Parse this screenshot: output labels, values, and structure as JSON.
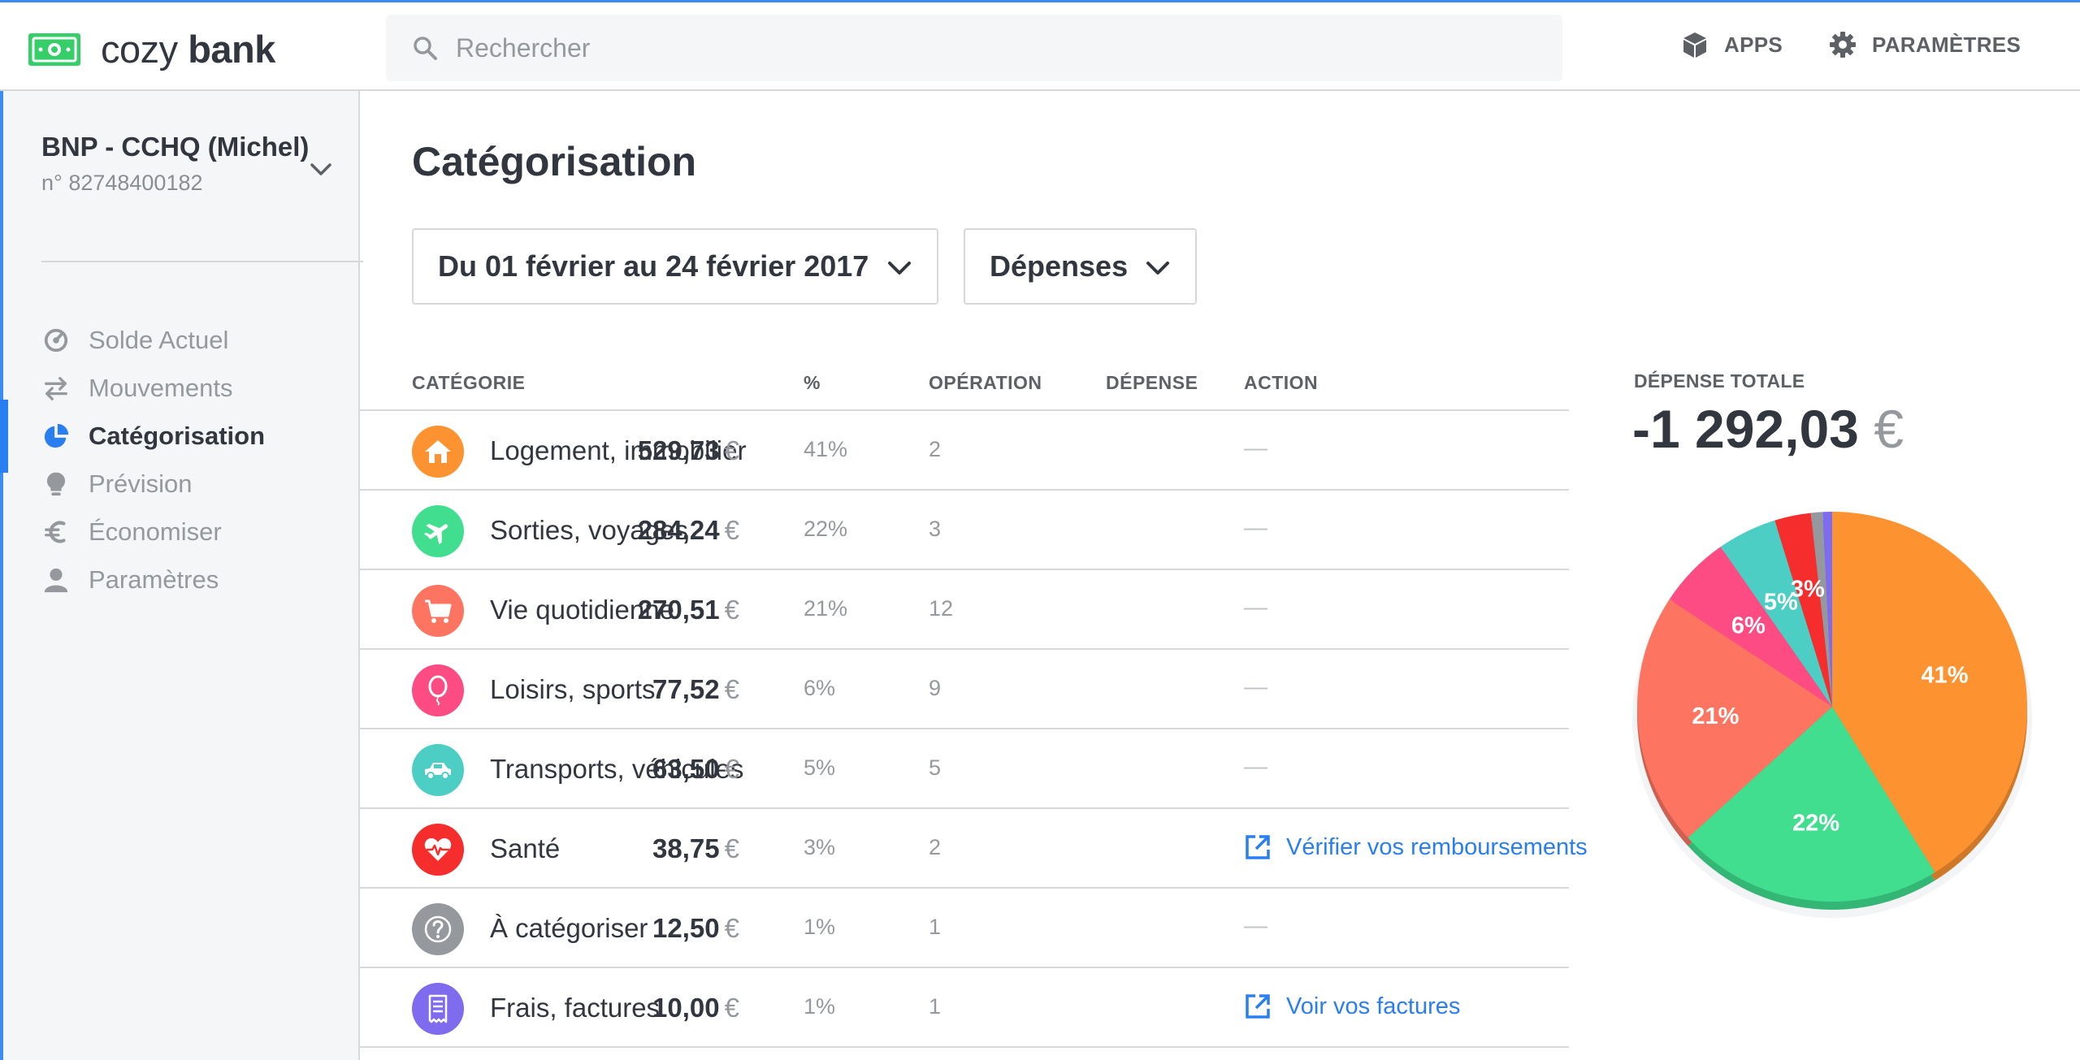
{
  "app": {
    "name_light": "cozy",
    "name_bold": "bank"
  },
  "search": {
    "placeholder": "Rechercher"
  },
  "topnav": {
    "apps_label": "APPS",
    "settings_label": "PARAMÈTRES"
  },
  "account": {
    "name": "BNP - CCHQ (Michel)",
    "number": "n° 82748400182"
  },
  "sidebar": {
    "items": [
      {
        "label": "Solde Actuel",
        "icon": "gauge-icon",
        "active": false
      },
      {
        "label": "Mouvements",
        "icon": "arrows-swap-icon",
        "active": false
      },
      {
        "label": "Catégorisation",
        "icon": "pie-chart-icon",
        "active": true
      },
      {
        "label": "Prévision",
        "icon": "lightbulb-icon",
        "active": false
      },
      {
        "label": "Économiser",
        "icon": "euro-icon",
        "active": false
      },
      {
        "label": "Paramètres",
        "icon": "user-icon",
        "active": false
      }
    ]
  },
  "page": {
    "title": "Catégorisation",
    "period_select": "Du 01 février au 24 février 2017",
    "kind_select": "Dépenses"
  },
  "table": {
    "headers": {
      "category": "CATÉGORIE",
      "percent": "%",
      "operation": "OPÉRATION",
      "expense": "DÉPENSE",
      "action": "ACTION"
    },
    "currency": "€",
    "rows": [
      {
        "category": "Logement, immobilier",
        "percent": "41%",
        "operations": "2",
        "amount": "529,73",
        "action": "—",
        "icon": "house-icon",
        "color": "#fc9230"
      },
      {
        "category": "Sorties, voyages",
        "percent": "22%",
        "operations": "3",
        "amount": "284,24",
        "action": "—",
        "icon": "plane-icon",
        "color": "#40de8e"
      },
      {
        "category": "Vie quotidienne",
        "percent": "21%",
        "operations": "12",
        "amount": "270,51",
        "action": "—",
        "icon": "cart-icon",
        "color": "#fd7461"
      },
      {
        "category": "Loisirs, sports",
        "percent": "6%",
        "operations": "9",
        "amount": "77,52",
        "action": "—",
        "icon": "balloon-icon",
        "color": "#fc4c83"
      },
      {
        "category": "Transports, véhicules",
        "percent": "5%",
        "operations": "5",
        "amount": "63,50",
        "action": "—",
        "icon": "car-icon",
        "color": "#4dcec5"
      },
      {
        "category": "Santé",
        "percent": "3%",
        "operations": "2",
        "amount": "38,75",
        "action": "Vérifier vos remboursements",
        "icon": "heart-icon",
        "color": "#f52d2d"
      },
      {
        "category": "À catégoriser",
        "percent": "1%",
        "operations": "1",
        "amount": "12,50",
        "action": "—",
        "icon": "question-icon",
        "color": "#95999d"
      },
      {
        "category": "Frais, factures",
        "percent": "1%",
        "operations": "1",
        "amount": "10,00",
        "action": "Voir vos factures",
        "icon": "receipt-icon",
        "color": "#7f6bee"
      }
    ]
  },
  "total": {
    "label": "DÉPENSE TOTALE",
    "value": "-1 292,03",
    "currency": "€"
  },
  "chart_data": {
    "type": "pie",
    "categories": [
      "Logement, immobilier",
      "Sorties, voyages",
      "Vie quotidienne",
      "Loisirs, sports",
      "Transports, véhicules",
      "Santé",
      "À catégoriser",
      "Frais, factures"
    ],
    "values": [
      529.73,
      284.24,
      270.51,
      77.52,
      63.5,
      38.75,
      12.5,
      10.0
    ],
    "labels": [
      "41%",
      "22%",
      "21%",
      "6%",
      "5%",
      "3%",
      "",
      ""
    ],
    "colors": [
      "#fc9230",
      "#40de8e",
      "#fd7461",
      "#fc4c83",
      "#4dcec5",
      "#f52d2d",
      "#95999d",
      "#7f6bee"
    ]
  }
}
